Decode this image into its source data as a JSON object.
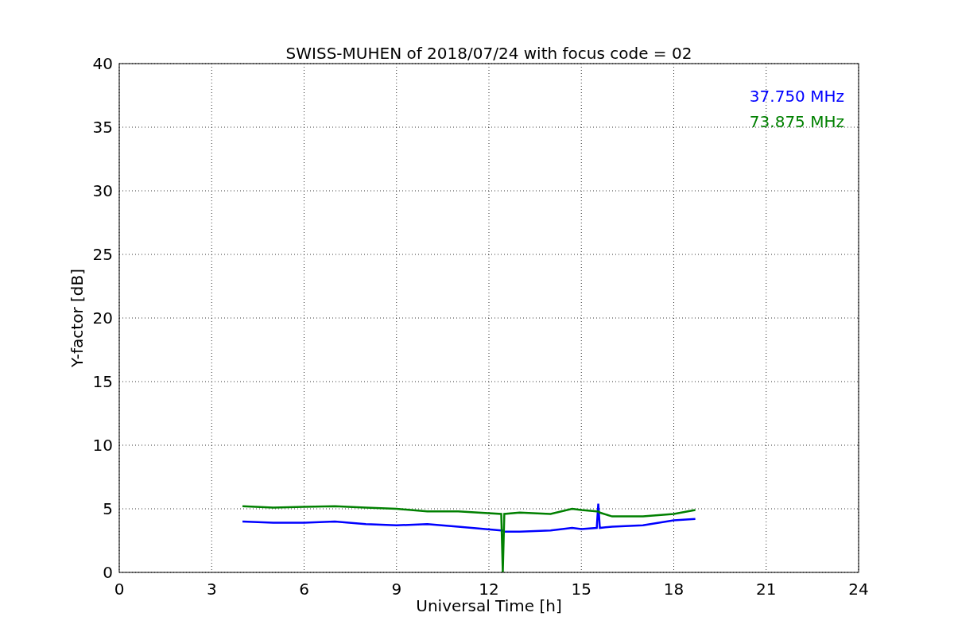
{
  "figure": {
    "chart_data": {
      "type": "line",
      "title": "SWISS-MUHEN of 2018/07/24 with focus code = 02",
      "xlabel": "Universal Time [h]",
      "ylabel": "Y-factor [dB]",
      "grid": true,
      "x": [
        4,
        5,
        6,
        7,
        8,
        9,
        10,
        11,
        12.4,
        12.45,
        12.5,
        13,
        14,
        14.7,
        15,
        15.5,
        15.55,
        15.6,
        16,
        17,
        18,
        18.7
      ],
      "series": [
        {
          "name": "37.750 MHz",
          "color": "#0000ff",
          "values": [
            4.0,
            3.9,
            3.9,
            4.0,
            3.8,
            3.7,
            3.8,
            3.6,
            3.3,
            3.3,
            3.2,
            3.2,
            3.3,
            3.5,
            3.4,
            3.5,
            5.4,
            3.5,
            3.6,
            3.7,
            4.1,
            4.2
          ]
        },
        {
          "name": "73.875 MHz",
          "color": "#008000",
          "values": [
            5.2,
            5.1,
            5.15,
            5.2,
            5.1,
            5.0,
            4.8,
            4.8,
            4.6,
            0,
            4.6,
            4.7,
            4.6,
            5.0,
            4.9,
            4.8,
            4.8,
            4.7,
            4.4,
            4.4,
            4.6,
            4.9
          ]
        }
      ],
      "xlim": [
        0,
        24
      ],
      "ylim": [
        0,
        40
      ],
      "xticks": [
        0,
        3,
        6,
        9,
        12,
        15,
        18,
        21,
        24
      ],
      "yticks": [
        0,
        5,
        10,
        15,
        20,
        25,
        30,
        35,
        40
      ]
    }
  }
}
